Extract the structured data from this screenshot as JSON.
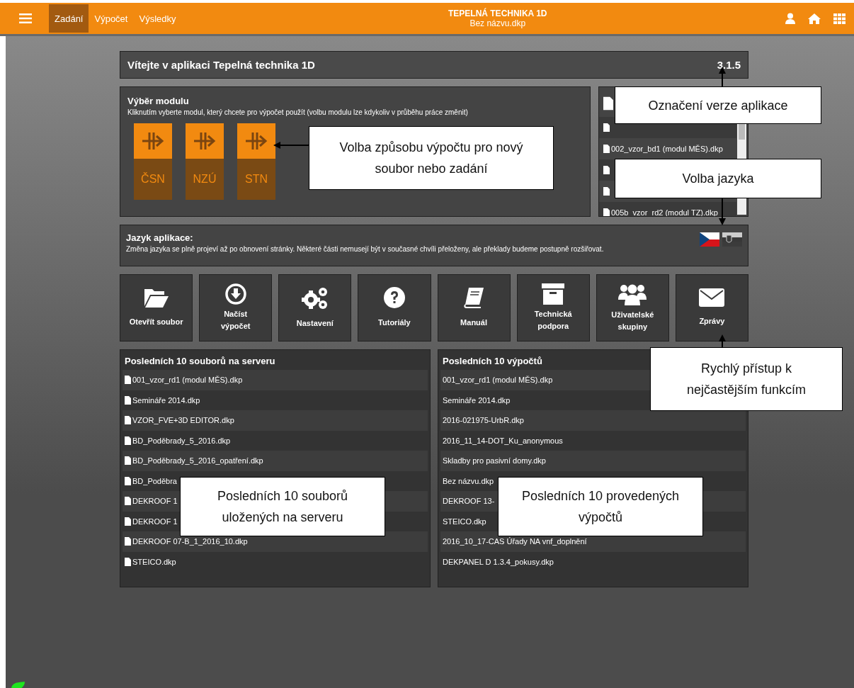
{
  "header": {
    "title": "TEPELNÁ TECHNIKA 1D",
    "file": "Bez názvu.dkp",
    "tabs": [
      {
        "label": "Zadání",
        "selected": true
      },
      {
        "label": "Výpočet",
        "selected": false
      },
      {
        "label": "Výsledky",
        "selected": false
      }
    ]
  },
  "welcome": {
    "title": "Vítejte v aplikaci Tepelná technika 1D",
    "version": "3.1.5"
  },
  "modules": {
    "title": "Výběr modulu",
    "hint": "Kliknutím vyberte modul, který chcete pro výpočet použít (volbu modulu lze kdykoliv v průběhu práce změnit)",
    "items": [
      {
        "label": "ČSN"
      },
      {
        "label": "NZÚ"
      },
      {
        "label": "STN"
      }
    ]
  },
  "recent_panel": {
    "rows": [
      {
        "kind": "file"
      },
      {
        "kind": "file"
      },
      {
        "kind": "file",
        "name": "002_vzor_bd1 (modul MĚS).dkp"
      },
      {
        "kind": "file"
      },
      {
        "kind": "file"
      },
      {
        "kind": "file",
        "name": "005b_vzor_rd2 (modul TZ).dkp"
      }
    ]
  },
  "language": {
    "title": "Jazyk aplikace:",
    "note": "Změna jazyka se plně projeví až po obnovení stránky. Některé části nemusejí být v současné chvíli přeloženy, ale překlady budeme postupně rozšiřovat.",
    "flags": [
      {
        "kind": "cz",
        "selected": true
      },
      {
        "kind": "sk",
        "selected": false
      }
    ]
  },
  "actions": [
    {
      "kind": "folder",
      "label": "Otevřít soubor"
    },
    {
      "kind": "download",
      "label": "Načíst výpočet"
    },
    {
      "kind": "gears",
      "label": "Nastavení"
    },
    {
      "kind": "question",
      "label": "Tutoriály"
    },
    {
      "kind": "book",
      "label": "Manuál"
    },
    {
      "kind": "archive",
      "label": "Technická podpora"
    },
    {
      "kind": "users",
      "label": "Uživatelské skupiny"
    },
    {
      "kind": "envelope",
      "label": "Zprávy"
    }
  ],
  "server_files": {
    "title": "Posledních 10 souborů na serveru",
    "rows": [
      {
        "name": "001_vzor_rd1 (modul MĚS).dkp"
      },
      {
        "name": "Semináře 2014.dkp"
      },
      {
        "name": "VZOR_FVE+3D EDITOR.dkp"
      },
      {
        "name": "BD_Poděbrady_5_2016.dkp"
      },
      {
        "name": "BD_Poděbrady_5_2016_opatření.dkp"
      },
      {
        "name": "BD_Poděbra"
      },
      {
        "name": "DEKROOF 1"
      },
      {
        "name": "DEKROOF 1"
      },
      {
        "name": "DEKROOF 07-B_1_2016_10.dkp"
      },
      {
        "name": "STEICO.dkp"
      }
    ]
  },
  "calculations": {
    "title": "Posledních 10 výpočtů",
    "rows": [
      {
        "name": "001_vzor_rd1 (modul MĚS).dkp"
      },
      {
        "name": "Semináře 2014.dkp"
      },
      {
        "name": "2016-021975-UrbR.dkp"
      },
      {
        "name": "2016_11_14-DOT_Ku_anonymous"
      },
      {
        "name": "Skladby pro pasivní domy.dkp"
      },
      {
        "name": "Bez názvu.dkp"
      },
      {
        "name": "DEKROOF 13-"
      },
      {
        "name": "STEICO.dkp"
      },
      {
        "name": "2016_10_17-CAS Úřady NA vnf_doplnění"
      },
      {
        "name": "DEKPANEL D 1.3.4_pokusy.dkp"
      }
    ]
  },
  "callouts": [
    {
      "text": "Označení verze aplikace"
    },
    {
      "text": "Volba způsobu výpočtu pro nový soubor nebo zadání"
    },
    {
      "text": "Volba jazyka"
    },
    {
      "text": "Rychlý přístup k nejčastějším funkcím"
    },
    {
      "text": "Posledních 10 souborů uložených na serveru"
    },
    {
      "text": "Posledních 10 provedených výpočtů"
    }
  ]
}
